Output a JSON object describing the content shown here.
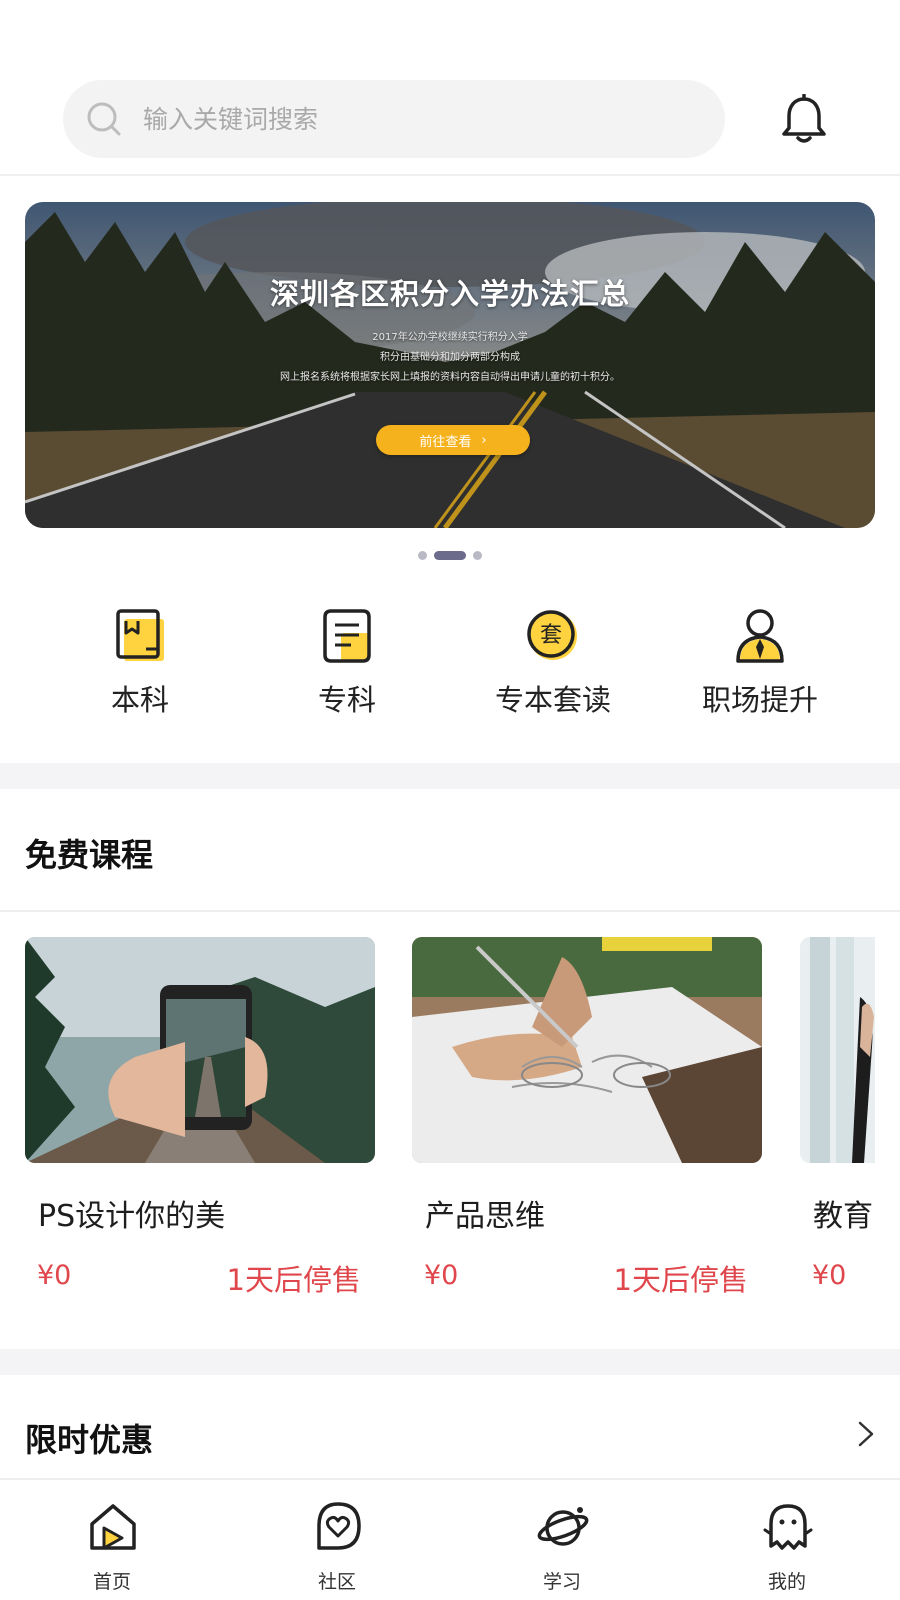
{
  "search": {
    "placeholder": "输入关键词搜索"
  },
  "banner": {
    "title": "深圳各区积分入学办法汇总",
    "lines": [
      "2017年公办学校继续实行积分入学",
      "积分由基础分和加分两部分构成",
      "网上报名系统将根据家长网上填报的资料内容自动得出申请儿童的初十积分。"
    ],
    "cta_label": "前往查看",
    "cta_arrow": "›",
    "slide_count": 3,
    "active_slide": 2
  },
  "categories": [
    {
      "label": "本科",
      "icon": "book-icon"
    },
    {
      "label": "专科",
      "icon": "document-icon"
    },
    {
      "label": "专本套读",
      "icon": "package-icon",
      "badge": "套"
    },
    {
      "label": "职场提升",
      "icon": "person-tie-icon"
    }
  ],
  "free_courses": {
    "title": "免费课程",
    "items": [
      {
        "name": "PS设计你的美",
        "price": "¥0",
        "status": "1天后停售"
      },
      {
        "name": "产品思维",
        "price": "¥0",
        "status": "1天后停售"
      },
      {
        "name": "教育",
        "price": "¥0",
        "status": ""
      }
    ]
  },
  "limited": {
    "title": "限时优惠"
  },
  "tabbar": {
    "items": [
      {
        "label": "首页",
        "icon": "home-icon"
      },
      {
        "label": "社区",
        "icon": "community-icon"
      },
      {
        "label": "学习",
        "icon": "planet-icon"
      },
      {
        "label": "我的",
        "icon": "profile-icon"
      }
    ]
  },
  "colors": {
    "accent": "#ffd23f",
    "price": "#e0474c",
    "icon_stroke": "#222222",
    "indicator": "#6c6b8b"
  }
}
